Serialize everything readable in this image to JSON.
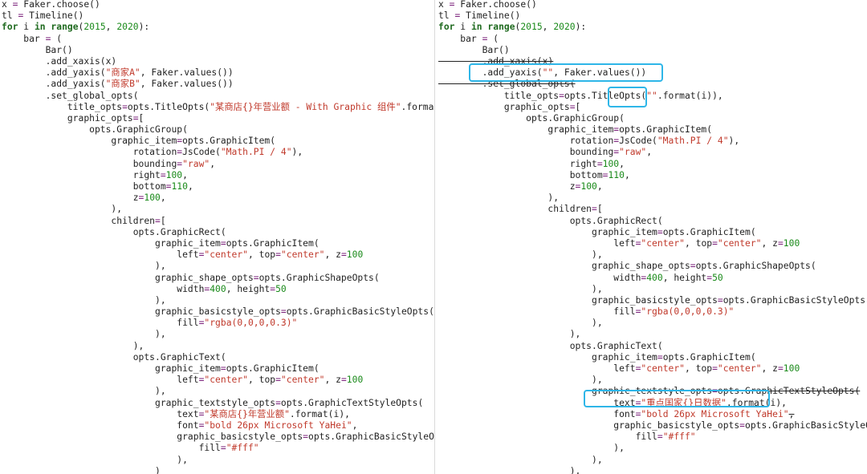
{
  "left_panel": {
    "lines": [
      [
        {
          "t": "x "
        },
        {
          "t": "=",
          "c": "o"
        },
        {
          "t": " Faker.choose()"
        }
      ],
      [
        {
          "t": "tl "
        },
        {
          "t": "=",
          "c": "o"
        },
        {
          "t": " Timeline()"
        }
      ],
      [
        {
          "t": "for",
          "c": "k"
        },
        {
          "t": " i "
        },
        {
          "t": "in",
          "c": "k"
        },
        {
          "t": " "
        },
        {
          "t": "range",
          "c": "k"
        },
        {
          "t": "("
        },
        {
          "t": "2015",
          "c": "n"
        },
        {
          "t": ", "
        },
        {
          "t": "2020",
          "c": "n"
        },
        {
          "t": "):"
        }
      ],
      [
        {
          "t": "    bar "
        },
        {
          "t": "=",
          "c": "o"
        },
        {
          "t": " ("
        }
      ],
      [
        {
          "t": "        Bar()"
        }
      ],
      [
        {
          "t": "        .add_xaxis(x)"
        }
      ],
      [
        {
          "t": "        .add_yaxis("
        },
        {
          "t": "\"商家A\"",
          "c": "s"
        },
        {
          "t": ", Faker.values())"
        }
      ],
      [
        {
          "t": "        .add_yaxis("
        },
        {
          "t": "\"商家B\"",
          "c": "s"
        },
        {
          "t": ", Faker.values())"
        }
      ],
      [
        {
          "t": "        .set_global_opts("
        }
      ],
      [
        {
          "t": "            title_opts"
        },
        {
          "t": "=",
          "c": "o"
        },
        {
          "t": "opts.TitleOpts("
        },
        {
          "t": "\"某商店{}年营业额 - With Graphic 组件\"",
          "c": "s"
        },
        {
          "t": ".format(i)),"
        }
      ],
      [
        {
          "t": "            graphic_opts"
        },
        {
          "t": "=",
          "c": "o"
        },
        {
          "t": "["
        }
      ],
      [
        {
          "t": "                opts.GraphicGroup("
        }
      ],
      [
        {
          "t": "                    graphic_item"
        },
        {
          "t": "=",
          "c": "o"
        },
        {
          "t": "opts.GraphicItem("
        }
      ],
      [
        {
          "t": "                        rotation"
        },
        {
          "t": "=",
          "c": "o"
        },
        {
          "t": "JsCode("
        },
        {
          "t": "\"Math.PI / 4\"",
          "c": "s"
        },
        {
          "t": "),"
        }
      ],
      [
        {
          "t": "                        bounding"
        },
        {
          "t": "=",
          "c": "o"
        },
        {
          "t": "\"raw\"",
          "c": "s"
        },
        {
          "t": ","
        }
      ],
      [
        {
          "t": "                        right"
        },
        {
          "t": "=",
          "c": "o"
        },
        {
          "t": "100",
          "c": "n"
        },
        {
          "t": ","
        }
      ],
      [
        {
          "t": "                        bottom"
        },
        {
          "t": "=",
          "c": "o"
        },
        {
          "t": "110",
          "c": "n"
        },
        {
          "t": ","
        }
      ],
      [
        {
          "t": "                        z"
        },
        {
          "t": "=",
          "c": "o"
        },
        {
          "t": "100",
          "c": "n"
        },
        {
          "t": ","
        }
      ],
      [
        {
          "t": "                    ),"
        }
      ],
      [
        {
          "t": "                    children"
        },
        {
          "t": "=",
          "c": "o"
        },
        {
          "t": "["
        }
      ],
      [
        {
          "t": "                        opts.GraphicRect("
        }
      ],
      [
        {
          "t": "                            graphic_item"
        },
        {
          "t": "=",
          "c": "o"
        },
        {
          "t": "opts.GraphicItem("
        }
      ],
      [
        {
          "t": "                                left"
        },
        {
          "t": "=",
          "c": "o"
        },
        {
          "t": "\"center\"",
          "c": "s"
        },
        {
          "t": ", top"
        },
        {
          "t": "=",
          "c": "o"
        },
        {
          "t": "\"center\"",
          "c": "s"
        },
        {
          "t": ", z"
        },
        {
          "t": "=",
          "c": "o"
        },
        {
          "t": "100",
          "c": "n"
        }
      ],
      [
        {
          "t": "                            ),"
        }
      ],
      [
        {
          "t": "                            graphic_shape_opts"
        },
        {
          "t": "=",
          "c": "o"
        },
        {
          "t": "opts.GraphicShapeOpts("
        }
      ],
      [
        {
          "t": "                                width"
        },
        {
          "t": "=",
          "c": "o"
        },
        {
          "t": "400",
          "c": "n"
        },
        {
          "t": ", height"
        },
        {
          "t": "=",
          "c": "o"
        },
        {
          "t": "50",
          "c": "n"
        }
      ],
      [
        {
          "t": "                            ),"
        }
      ],
      [
        {
          "t": "                            graphic_basicstyle_opts"
        },
        {
          "t": "=",
          "c": "o"
        },
        {
          "t": "opts.GraphicBasicStyleOpts("
        }
      ],
      [
        {
          "t": "                                fill"
        },
        {
          "t": "=",
          "c": "o"
        },
        {
          "t": "\"rgba(0,0,0,0.3)\"",
          "c": "s"
        }
      ],
      [
        {
          "t": "                            ),"
        }
      ],
      [
        {
          "t": "                        ),"
        }
      ],
      [
        {
          "t": "                        opts.GraphicText("
        }
      ],
      [
        {
          "t": "                            graphic_item"
        },
        {
          "t": "=",
          "c": "o"
        },
        {
          "t": "opts.GraphicItem("
        }
      ],
      [
        {
          "t": "                                left"
        },
        {
          "t": "=",
          "c": "o"
        },
        {
          "t": "\"center\"",
          "c": "s"
        },
        {
          "t": ", top"
        },
        {
          "t": "=",
          "c": "o"
        },
        {
          "t": "\"center\"",
          "c": "s"
        },
        {
          "t": ", z"
        },
        {
          "t": "=",
          "c": "o"
        },
        {
          "t": "100",
          "c": "n"
        }
      ],
      [
        {
          "t": "                            ),"
        }
      ],
      [
        {
          "t": "                            graphic_textstyle_opts"
        },
        {
          "t": "=",
          "c": "o"
        },
        {
          "t": "opts.GraphicTextStyleOpts("
        }
      ],
      [
        {
          "t": "                                text"
        },
        {
          "t": "=",
          "c": "o"
        },
        {
          "t": "\"某商店{}年营业额\"",
          "c": "s"
        },
        {
          "t": ".format(i),"
        }
      ],
      [
        {
          "t": "                                font"
        },
        {
          "t": "=",
          "c": "o"
        },
        {
          "t": "\"bold 26px Microsoft YaHei\"",
          "c": "s"
        },
        {
          "t": ","
        }
      ],
      [
        {
          "t": "                                graphic_basicstyle_opts"
        },
        {
          "t": "=",
          "c": "o"
        },
        {
          "t": "opts.GraphicBasicStyleOpts("
        }
      ],
      [
        {
          "t": "                                    fill"
        },
        {
          "t": "=",
          "c": "o"
        },
        {
          "t": "\"#fff\"",
          "c": "s"
        }
      ],
      [
        {
          "t": "                                ),"
        }
      ],
      [
        {
          "t": "                            )"
        }
      ]
    ]
  },
  "right_panel": {
    "lines": [
      [
        {
          "t": "x "
        },
        {
          "t": "=",
          "c": "o"
        },
        {
          "t": " Faker.choose()"
        }
      ],
      [
        {
          "t": "tl "
        },
        {
          "t": "=",
          "c": "o"
        },
        {
          "t": " Timeline()"
        }
      ],
      [
        {
          "t": "for",
          "c": "k"
        },
        {
          "t": " i "
        },
        {
          "t": "in",
          "c": "k"
        },
        {
          "t": " "
        },
        {
          "t": "range",
          "c": "k"
        },
        {
          "t": "("
        },
        {
          "t": "2015",
          "c": "n"
        },
        {
          "t": ", "
        },
        {
          "t": "2020",
          "c": "n"
        },
        {
          "t": "):"
        }
      ],
      [
        {
          "t": "    bar "
        },
        {
          "t": "=",
          "c": "o"
        },
        {
          "t": " ("
        }
      ],
      [
        {
          "t": "        Bar()"
        }
      ],
      [
        {
          "t": "        .add_xaxis(x)",
          "c": "strike"
        }
      ],
      [
        {
          "t": "        .add_yaxis("
        },
        {
          "t": "\"\"",
          "c": "s"
        },
        {
          "t": ", Faker.values())"
        }
      ],
      [
        {
          "t": "        .set_global_opts(",
          "c": "strike"
        }
      ],
      [
        {
          "t": "            title_opts"
        },
        {
          "t": "=",
          "c": "o"
        },
        {
          "t": "opts.TitleOpts("
        },
        {
          "t": "\"\"",
          "c": "s"
        },
        {
          "t": ".format(i)),"
        }
      ],
      [
        {
          "t": "            graphic_opts"
        },
        {
          "t": "=",
          "c": "o"
        },
        {
          "t": "["
        }
      ],
      [
        {
          "t": "                opts.GraphicGroup("
        }
      ],
      [
        {
          "t": "                    graphic_item"
        },
        {
          "t": "=",
          "c": "o"
        },
        {
          "t": "opts.GraphicItem("
        }
      ],
      [
        {
          "t": "                        rotation"
        },
        {
          "t": "=",
          "c": "o"
        },
        {
          "t": "JsCode("
        },
        {
          "t": "\"Math.PI / 4\"",
          "c": "s"
        },
        {
          "t": "),"
        }
      ],
      [
        {
          "t": "                        bounding"
        },
        {
          "t": "=",
          "c": "o"
        },
        {
          "t": "\"raw\"",
          "c": "s"
        },
        {
          "t": ","
        }
      ],
      [
        {
          "t": "                        right"
        },
        {
          "t": "=",
          "c": "o"
        },
        {
          "t": "100",
          "c": "n"
        },
        {
          "t": ","
        }
      ],
      [
        {
          "t": "                        bottom"
        },
        {
          "t": "=",
          "c": "o"
        },
        {
          "t": "110",
          "c": "n"
        },
        {
          "t": ","
        }
      ],
      [
        {
          "t": "                        z"
        },
        {
          "t": "=",
          "c": "o"
        },
        {
          "t": "100",
          "c": "n"
        },
        {
          "t": ","
        }
      ],
      [
        {
          "t": "                    ),"
        }
      ],
      [
        {
          "t": "                    children"
        },
        {
          "t": "=",
          "c": "o"
        },
        {
          "t": "["
        }
      ],
      [
        {
          "t": "                        opts.GraphicRect("
        }
      ],
      [
        {
          "t": "                            graphic_item"
        },
        {
          "t": "=",
          "c": "o"
        },
        {
          "t": "opts.GraphicItem("
        }
      ],
      [
        {
          "t": "                                left"
        },
        {
          "t": "=",
          "c": "o"
        },
        {
          "t": "\"center\"",
          "c": "s"
        },
        {
          "t": ", top"
        },
        {
          "t": "=",
          "c": "o"
        },
        {
          "t": "\"center\"",
          "c": "s"
        },
        {
          "t": ", z"
        },
        {
          "t": "=",
          "c": "o"
        },
        {
          "t": "100",
          "c": "n"
        }
      ],
      [
        {
          "t": "                            ),"
        }
      ],
      [
        {
          "t": "                            graphic_shape_opts"
        },
        {
          "t": "=",
          "c": "o"
        },
        {
          "t": "opts.GraphicShapeOpts("
        }
      ],
      [
        {
          "t": "                                width"
        },
        {
          "t": "=",
          "c": "o"
        },
        {
          "t": "400",
          "c": "n"
        },
        {
          "t": ", height"
        },
        {
          "t": "=",
          "c": "o"
        },
        {
          "t": "50",
          "c": "n"
        }
      ],
      [
        {
          "t": "                            ),"
        }
      ],
      [
        {
          "t": "                            graphic_basicstyle_opts"
        },
        {
          "t": "=",
          "c": "o"
        },
        {
          "t": "opts.GraphicBasicStyleOpts("
        }
      ],
      [
        {
          "t": "                                fill"
        },
        {
          "t": "=",
          "c": "o"
        },
        {
          "t": "\"rgba(0,0,0,0.3)\"",
          "c": "s"
        }
      ],
      [
        {
          "t": "                            ),"
        }
      ],
      [
        {
          "t": "                        ),"
        }
      ],
      [
        {
          "t": "                        opts.GraphicText("
        }
      ],
      [
        {
          "t": "                            graphic_item"
        },
        {
          "t": "=",
          "c": "o"
        },
        {
          "t": "opts.GraphicItem("
        }
      ],
      [
        {
          "t": "                                left"
        },
        {
          "t": "=",
          "c": "o"
        },
        {
          "t": "\"center\"",
          "c": "s"
        },
        {
          "t": ", top"
        },
        {
          "t": "=",
          "c": "o"
        },
        {
          "t": "\"center\"",
          "c": "s"
        },
        {
          "t": ", z"
        },
        {
          "t": "=",
          "c": "o"
        },
        {
          "t": "100",
          "c": "n"
        }
      ],
      [
        {
          "t": "                            ),"
        }
      ],
      [
        {
          "t": "                            graphic_textstyle_opts"
        },
        {
          "t": "=",
          "c": "o"
        },
        {
          "t": "opts.GraphicTextStyleOpts(",
          "c": "strike"
        }
      ],
      [
        {
          "t": "                                text"
        },
        {
          "t": "=",
          "c": "o"
        },
        {
          "t": "\"重点国家{}日数据\"",
          "c": "s"
        },
        {
          "t": ".format(i),"
        }
      ],
      [
        {
          "t": "                                font"
        },
        {
          "t": "=",
          "c": "o"
        },
        {
          "t": "\"bold 26px Microsoft YaHei\"",
          "c": "s"
        },
        {
          "t": ",",
          "c": "strike"
        }
      ],
      [
        {
          "t": "                                graphic_basicstyle_opts"
        },
        {
          "t": "=",
          "c": "o"
        },
        {
          "t": "opts.GraphicBasicStyleOpts("
        }
      ],
      [
        {
          "t": "                                    fill"
        },
        {
          "t": "=",
          "c": "o"
        },
        {
          "t": "\"#fff\"",
          "c": "s"
        }
      ],
      [
        {
          "t": "                                ),"
        }
      ],
      [
        {
          "t": "                            ),"
        }
      ],
      [
        {
          "t": "                        ),"
        }
      ]
    ]
  },
  "colors": {
    "keyword": "#1f6a1f",
    "string": "#c0392b",
    "number": "#1a8a1a",
    "operator": "#7a1f7a",
    "highlight_box": "#2eb6e8"
  }
}
